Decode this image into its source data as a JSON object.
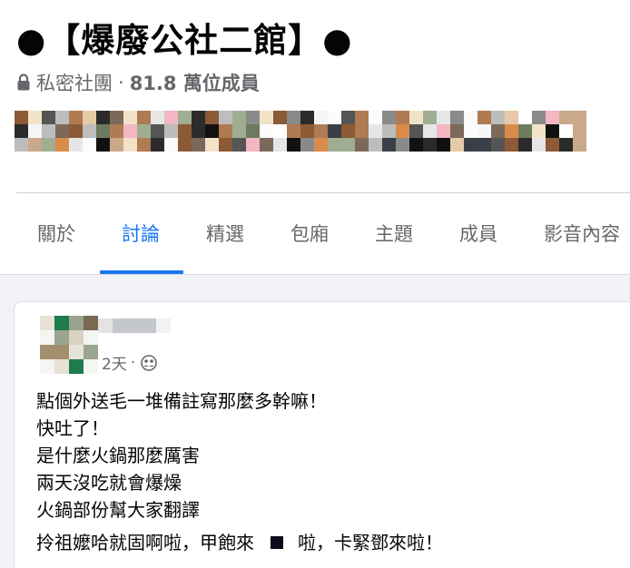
{
  "group": {
    "title": "●【爆廢公社二館】●",
    "privacy_label": "私密社團",
    "separator": "·",
    "member_count": "81.8 萬位成員"
  },
  "tabs": [
    {
      "label": "關於",
      "active": false
    },
    {
      "label": "討論",
      "active": true
    },
    {
      "label": "精選",
      "active": false
    },
    {
      "label": "包廂",
      "active": false
    },
    {
      "label": "主題",
      "active": false
    },
    {
      "label": "成員",
      "active": false
    },
    {
      "label": "影音內容",
      "active": false
    }
  ],
  "post": {
    "time": "2天",
    "time_separator": "·",
    "lines": [
      "點個外送毛一堆備註寫那麼多幹嘛！",
      "快吐了！",
      "是什麼火鍋那麼厲害",
      "兩天沒吃就會爆燥",
      "火鍋部份幫大家翻譯"
    ],
    "last_line_before": "拎祖嬤哈就固啊啦，甲飽來",
    "last_line_after": "啦，卡緊鄧來啦！"
  },
  "colors": {
    "accent": "#1877f2",
    "muted_text": "#65676b",
    "background": "#f0f2f5"
  },
  "icons": {
    "privacy": "lock-icon",
    "audience": "group-audience-icon"
  }
}
